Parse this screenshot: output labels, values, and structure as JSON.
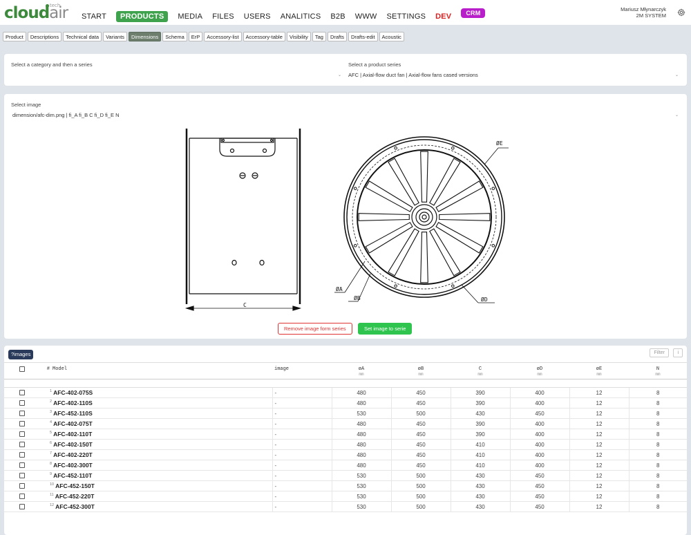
{
  "header": {
    "logo_main": "cloud",
    "logo_air": "air",
    "logo_tech": "tech",
    "nav": [
      "START",
      "PRODUCTS",
      "MEDIA",
      "FILES",
      "USERS",
      "ANALITICS",
      "B2B",
      "WWW",
      "SETTINGS",
      "DEV",
      "CRM"
    ],
    "active_nav": "PRODUCTS",
    "user_name": "Mariusz Młynarczyk",
    "user_company": "2M SYSTEM"
  },
  "subtabs": [
    "Product",
    "Descriptions",
    "Technical data",
    "Variants",
    "Dimensions",
    "Schema",
    "ErP",
    "Accessory-list",
    "Accessory-table",
    "Visibility",
    "Tag",
    "Drafts",
    "Drafts-edit",
    "Acoustic"
  ],
  "active_subtab": "Dimensions",
  "series_card": {
    "category_label": "Select a category and then a series",
    "category_value": "",
    "series_label": "Select a product series",
    "series_value": "AFC | Axial-flow duct fan | Axial-flow fans cased versions"
  },
  "image_card": {
    "label": "Select image",
    "value": "dimension/afc-dim.png | fi_A fi_B C fi_D fi_E N",
    "drawing_labels": {
      "c": "C",
      "a": "ØA",
      "b": "ØB",
      "d": "ØD",
      "e": "ØE"
    },
    "remove_button": "Remove image form series",
    "set_button": "Set image to serie"
  },
  "table_card": {
    "tag": "?images",
    "filter_button": "Filter",
    "info_button": "i",
    "columns": [
      {
        "key": "model",
        "label": "Model",
        "unit": ""
      },
      {
        "key": "image",
        "label": "image",
        "unit": ""
      },
      {
        "key": "a",
        "label": "øA",
        "unit": "mm"
      },
      {
        "key": "b",
        "label": "øB",
        "unit": "mm"
      },
      {
        "key": "c",
        "label": "C",
        "unit": "mm"
      },
      {
        "key": "d",
        "label": "øD",
        "unit": "mm"
      },
      {
        "key": "e",
        "label": "øE",
        "unit": "mm"
      },
      {
        "key": "n",
        "label": "N",
        "unit": "mm"
      }
    ],
    "hash_label": "#",
    "rows": [
      {
        "idx": "1",
        "model": "AFC-402-075S",
        "image": "-",
        "a": "480",
        "b": "450",
        "c": "390",
        "d": "400",
        "e": "12",
        "n": "8"
      },
      {
        "idx": "2",
        "model": "AFC-402-110S",
        "image": "-",
        "a": "480",
        "b": "450",
        "c": "390",
        "d": "400",
        "e": "12",
        "n": "8"
      },
      {
        "idx": "3",
        "model": "AFC-452-110S",
        "image": "-",
        "a": "530",
        "b": "500",
        "c": "430",
        "d": "450",
        "e": "12",
        "n": "8"
      },
      {
        "idx": "4",
        "model": "AFC-402-075T",
        "image": "-",
        "a": "480",
        "b": "450",
        "c": "390",
        "d": "400",
        "e": "12",
        "n": "8"
      },
      {
        "idx": "5",
        "model": "AFC-402-110T",
        "image": "-",
        "a": "480",
        "b": "450",
        "c": "390",
        "d": "400",
        "e": "12",
        "n": "8"
      },
      {
        "idx": "6",
        "model": "AFC-402-150T",
        "image": "-",
        "a": "480",
        "b": "450",
        "c": "410",
        "d": "400",
        "e": "12",
        "n": "8"
      },
      {
        "idx": "7",
        "model": "AFC-402-220T",
        "image": "-",
        "a": "480",
        "b": "450",
        "c": "410",
        "d": "400",
        "e": "12",
        "n": "8"
      },
      {
        "idx": "8",
        "model": "AFC-402-300T",
        "image": "-",
        "a": "480",
        "b": "450",
        "c": "410",
        "d": "400",
        "e": "12",
        "n": "8"
      },
      {
        "idx": "9",
        "model": "AFC-452-110T",
        "image": "-",
        "a": "530",
        "b": "500",
        "c": "430",
        "d": "450",
        "e": "12",
        "n": "8"
      },
      {
        "idx": "10",
        "model": "AFC-452-150T",
        "image": "-",
        "a": "530",
        "b": "500",
        "c": "430",
        "d": "450",
        "e": "12",
        "n": "8"
      },
      {
        "idx": "11",
        "model": "AFC-452-220T",
        "image": "-",
        "a": "530",
        "b": "500",
        "c": "430",
        "d": "450",
        "e": "12",
        "n": "8"
      },
      {
        "idx": "12",
        "model": "AFC-452-300T",
        "image": "-",
        "a": "530",
        "b": "500",
        "c": "430",
        "d": "450",
        "e": "12",
        "n": "8"
      }
    ]
  }
}
